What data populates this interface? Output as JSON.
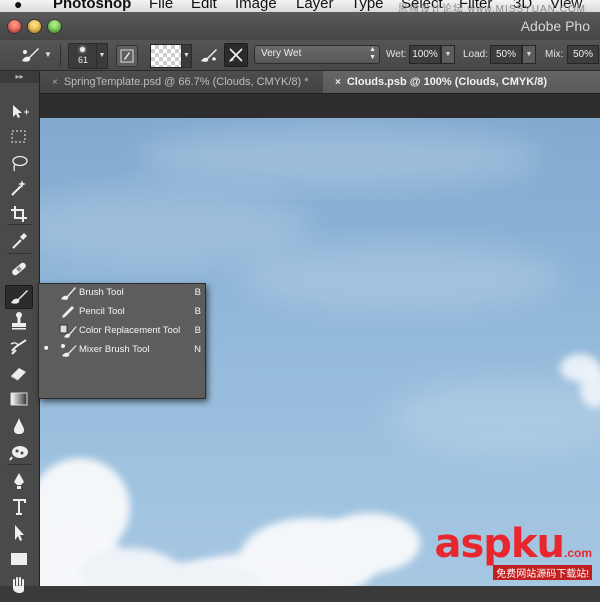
{
  "menubar": {
    "app_name": "Photoshop",
    "items": [
      "File",
      "Edit",
      "Image",
      "Layer",
      "Type",
      "Select",
      "Filter",
      "3D",
      "View"
    ],
    "watermark": "思缘设计论坛 www.MISSYUAN.COM"
  },
  "titlebar": {
    "title": "Adobe Pho"
  },
  "options": {
    "brush_size": "61",
    "mix_preset": "Very Wet",
    "wet_label": "Wet:",
    "wet_value": "100%",
    "load_label": "Load:",
    "load_value": "50%",
    "mix_label": "Mix:",
    "mix_value": "50%"
  },
  "tabs": [
    {
      "label": "SpringTemplate.psd @ 66.7% (Clouds, CMYK/8) *",
      "close": "×",
      "active": false
    },
    {
      "label": "Clouds.psb @ 100% (Clouds, CMYK/8)",
      "close": "×",
      "active": true
    }
  ],
  "toolbar": {
    "collapse": "▸▸",
    "tools": [
      {
        "name": "move-tool",
        "icon": "move-icon"
      },
      {
        "name": "marquee-tool",
        "icon": "marquee-icon"
      },
      {
        "name": "lasso-tool",
        "icon": "lasso-icon"
      },
      {
        "name": "magic-wand-tool",
        "icon": "magic-wand-icon"
      },
      {
        "name": "crop-tool",
        "icon": "crop-icon"
      },
      {
        "name": "eyedropper-tool",
        "icon": "eyedropper-icon"
      },
      {
        "name": "healing-brush-tool",
        "icon": "bandage-icon"
      },
      {
        "name": "brush-tool",
        "icon": "brush-icon"
      },
      {
        "name": "stamp-tool",
        "icon": "stamp-icon"
      },
      {
        "name": "history-brush-tool",
        "icon": "history-brush-icon"
      },
      {
        "name": "eraser-tool",
        "icon": "eraser-icon"
      },
      {
        "name": "gradient-tool",
        "icon": "gradient-icon"
      },
      {
        "name": "blur-tool",
        "icon": "blur-icon"
      },
      {
        "name": "dodge-tool",
        "icon": "dodge-icon"
      },
      {
        "name": "pen-tool",
        "icon": "pen-icon"
      },
      {
        "name": "type-tool",
        "icon": "type-icon"
      },
      {
        "name": "path-selection-tool",
        "icon": "arrow-icon"
      },
      {
        "name": "shape-tool",
        "icon": "rectangle-icon"
      },
      {
        "name": "hand-tool",
        "icon": "hand-icon"
      }
    ]
  },
  "flyout": {
    "items": [
      {
        "label": "Brush Tool",
        "key": "B",
        "checked": false,
        "icon": "brush-icon"
      },
      {
        "label": "Pencil Tool",
        "key": "B",
        "checked": false,
        "icon": "pencil-icon"
      },
      {
        "label": "Color Replacement Tool",
        "key": "B",
        "checked": false,
        "icon": "color-replacement-icon"
      },
      {
        "label": "Mixer Brush Tool",
        "key": "N",
        "checked": true,
        "icon": "mixer-brush-icon"
      }
    ],
    "check_mark": "■"
  },
  "watermark": {
    "main": "aspku",
    "suffix": ".com",
    "sub": "免费网站源码下载站!"
  },
  "colors": {
    "sky_top": "#82aacf",
    "sky_bottom": "#a6c7e2",
    "watermark_red": "#e8262d",
    "ui_dark": "#4a4a4a"
  }
}
